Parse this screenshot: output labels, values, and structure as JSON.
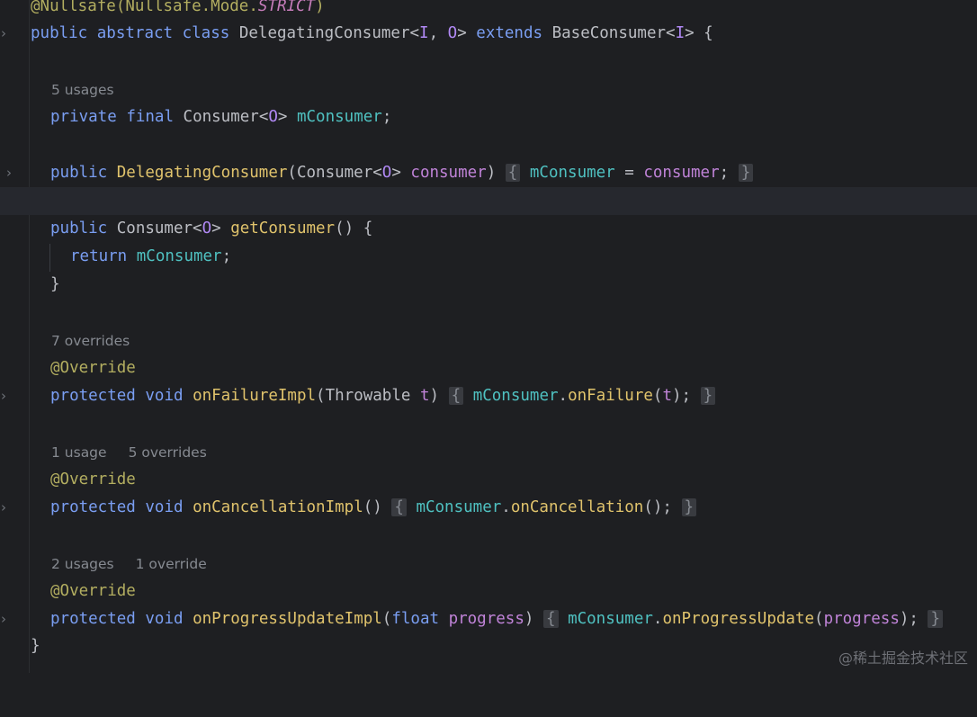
{
  "code": {
    "line1": {
      "annotation": "@Nullsafe(Nullsafe.Mode.",
      "strict": "STRICT",
      "close": ")"
    },
    "line2": {
      "public": "public",
      "abstract": "abstract",
      "class": "class",
      "name": "DelegatingConsumer<",
      "tI": "I",
      "comma": ", ",
      "tO": "O",
      "gt": "> ",
      "extends": "extends",
      "base": " BaseConsumer<",
      "tI2": "I",
      "tail": "> {"
    },
    "hint1": "5 usages",
    "line3": {
      "private": "private",
      "final": "final",
      "type": " Consumer<",
      "tO": "O",
      "gt": "> ",
      "field": "mConsumer",
      "semi": ";"
    },
    "line4": {
      "public": "public",
      "ctor": "DelegatingConsumer",
      "open": "(Consumer<",
      "tO": "O",
      "gt": "> ",
      "param": "consumer",
      "close": ")",
      "lbrace": "{",
      "field": "mConsumer",
      "eq": " = ",
      "param2": "consumer",
      "semi": ";",
      "rbrace": "}"
    },
    "line5": {
      "public": "public",
      "type": " Consumer<",
      "tO": "O",
      "gt": "> ",
      "method": "getConsumer",
      "tail": "() {"
    },
    "line6": {
      "return": "return",
      "field": "mConsumer",
      "semi": ";"
    },
    "line7": {
      "rbrace": "}"
    },
    "hint2": "7 overrides",
    "override1": "@Override",
    "line8": {
      "protected": "protected",
      "void": "void",
      "method": "onFailureImpl",
      "open": "(Throwable ",
      "param": "t",
      "close": ")",
      "lbrace": "{",
      "field": "mConsumer",
      "dot": ".",
      "call": "onFailure",
      "args_open": "(",
      "arg": "t",
      "args_close": ");",
      "rbrace": "}"
    },
    "hint3a": "1 usage",
    "hint3b": "5 overrides",
    "override2": "@Override",
    "line9": {
      "protected": "protected",
      "void": "void",
      "method": "onCancellationImpl",
      "parens": "()",
      "lbrace": "{",
      "field": "mConsumer",
      "dot": ".",
      "call": "onCancellation",
      "tail": "();",
      "rbrace": "}"
    },
    "hint4a": "2 usages",
    "hint4b": "1 override",
    "override3": "@Override",
    "line10": {
      "protected": "protected",
      "void": "void",
      "method": "onProgressUpdateImpl",
      "open": "(",
      "float": "float",
      "param": "progress",
      "close": ")",
      "lbrace": "{",
      "field": "mConsumer",
      "dot": ".",
      "call": "onProgressUpdate",
      "args_open": "(",
      "arg": "progress",
      "args_close": ");",
      "rbrace": "}"
    },
    "line11": {
      "rbrace": "}"
    }
  },
  "gutter": {
    "fold_icon": "chevron-right-icon",
    "fold_glyph": "›"
  },
  "watermark": "@稀土掘金技术社区",
  "colors": {
    "background": "#1e1f22",
    "keyword": "#cf8e6d",
    "annotation": "#b3ae60",
    "field": "#4fc1c1",
    "method": "#e0c36c",
    "parameter": "#c083d8",
    "type_param": "#b189f5",
    "hint": "#868a91"
  }
}
